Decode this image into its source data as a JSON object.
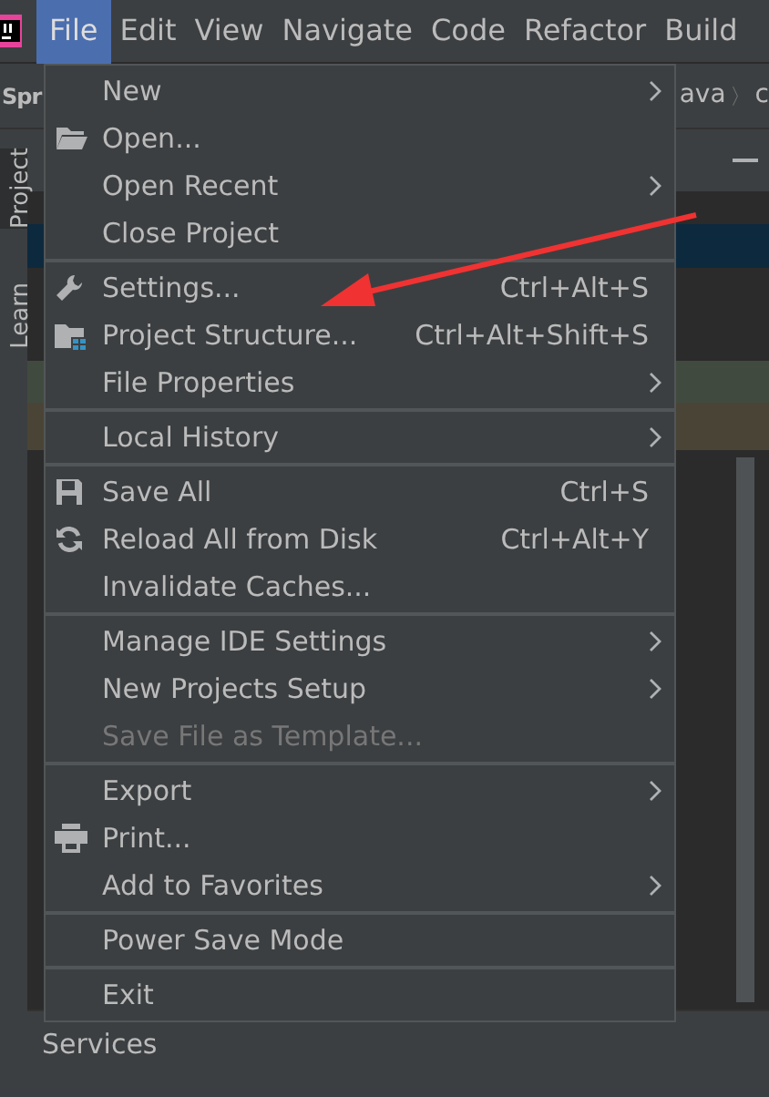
{
  "menubar": [
    {
      "label": "File",
      "selected": true
    },
    {
      "label": "Edit",
      "selected": false
    },
    {
      "label": "View",
      "selected": false
    },
    {
      "label": "Navigate",
      "selected": false
    },
    {
      "label": "Code",
      "selected": false
    },
    {
      "label": "Refactor",
      "selected": false
    },
    {
      "label": "Build",
      "selected": false
    }
  ],
  "background": {
    "project_name": "Spr",
    "breadcrumb": "ava",
    "breadcrumb_separator": "〉",
    "breadcrumb_next": "c",
    "side_tabs": [
      "Project",
      "Learn"
    ],
    "bottom_panel": "Services"
  },
  "file_menu": [
    [
      {
        "label": "New",
        "kind": "plain",
        "submenu": true,
        "disabled": false
      },
      {
        "label": "Open...",
        "kind": "folder",
        "submenu": false,
        "disabled": false
      },
      {
        "label": "Open Recent",
        "kind": "plain",
        "submenu": true,
        "disabled": false
      },
      {
        "label": "Close Project",
        "kind": "plain",
        "submenu": false,
        "disabled": false
      }
    ],
    [
      {
        "label": "Settings...",
        "kind": "wrench",
        "shortcut": "Ctrl+Alt+S",
        "submenu": false,
        "disabled": false
      },
      {
        "label": "Project Structure...",
        "kind": "project",
        "shortcut": "Ctrl+Alt+Shift+S",
        "submenu": false,
        "disabled": false
      },
      {
        "label": "File Properties",
        "kind": "plain",
        "submenu": true,
        "disabled": false
      }
    ],
    [
      {
        "label": "Local History",
        "kind": "plain",
        "submenu": true,
        "disabled": false
      }
    ],
    [
      {
        "label": "Save All",
        "kind": "save",
        "shortcut": "Ctrl+S",
        "submenu": false,
        "disabled": false
      },
      {
        "label": "Reload All from Disk",
        "kind": "reload",
        "shortcut": "Ctrl+Alt+Y",
        "submenu": false,
        "disabled": false
      },
      {
        "label": "Invalidate Caches...",
        "kind": "plain",
        "submenu": false,
        "disabled": false
      }
    ],
    [
      {
        "label": "Manage IDE Settings",
        "kind": "plain",
        "submenu": true,
        "disabled": false
      },
      {
        "label": "New Projects Setup",
        "kind": "plain",
        "submenu": true,
        "disabled": false
      },
      {
        "label": "Save File as Template...",
        "kind": "plain",
        "submenu": false,
        "disabled": true
      }
    ],
    [
      {
        "label": "Export",
        "kind": "plain",
        "submenu": true,
        "disabled": false
      },
      {
        "label": "Print...",
        "kind": "print",
        "submenu": false,
        "disabled": false
      },
      {
        "label": "Add to Favorites",
        "kind": "plain",
        "submenu": true,
        "disabled": false
      }
    ],
    [
      {
        "label": "Power Save Mode",
        "kind": "plain",
        "submenu": false,
        "disabled": false
      }
    ],
    [
      {
        "label": "Exit",
        "kind": "plain",
        "submenu": false,
        "disabled": false
      }
    ]
  ]
}
